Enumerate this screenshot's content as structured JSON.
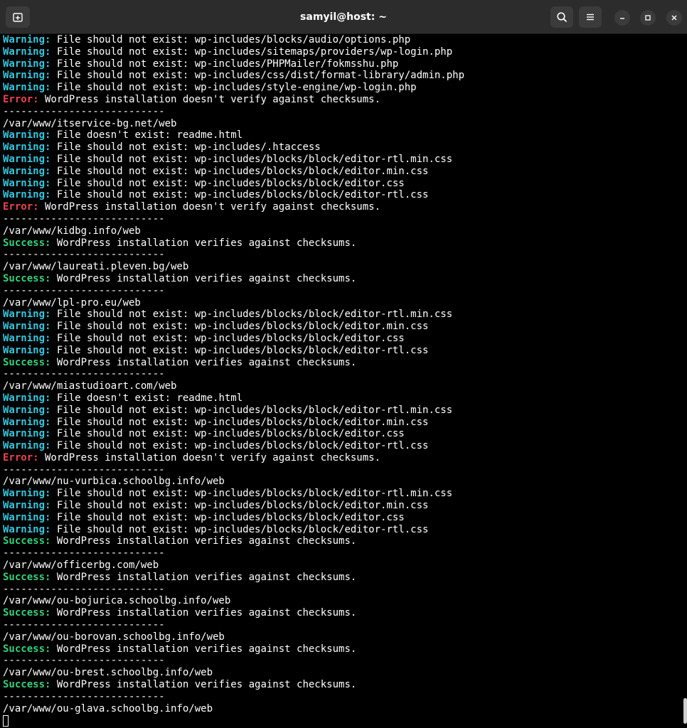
{
  "window": {
    "title": "samyil@host: ~"
  },
  "icons": {
    "new_tab": "new-tab-icon",
    "search": "search-icon",
    "menu": "hamburger-menu-icon",
    "minimize": "minimize-icon",
    "maximize": "maximize-icon",
    "close": "close-icon"
  },
  "colors": {
    "warning": "#33c7de",
    "error": "#f0414f",
    "success": "#33d17a",
    "text": "#ffffff",
    "background": "#000000"
  },
  "terminal": {
    "lines": [
      {
        "level": "Warning:",
        "text": " File should not exist: wp-includes/blocks/audio/options.php"
      },
      {
        "level": "Warning:",
        "text": " File should not exist: wp-includes/sitemaps/providers/wp-login.php"
      },
      {
        "level": "Warning:",
        "text": " File should not exist: wp-includes/PHPMailer/fokmsshu.php"
      },
      {
        "level": "Warning:",
        "text": " File should not exist: wp-includes/css/dist/format-library/admin.php"
      },
      {
        "level": "Warning:",
        "text": " File should not exist: wp-includes/style-engine/wp-login.php"
      },
      {
        "level": "Error:",
        "text": " WordPress installation doesn't verify against checksums."
      },
      {
        "level": "",
        "text": "---------------------------"
      },
      {
        "level": "",
        "text": "/var/www/itservice-bg.net/web"
      },
      {
        "level": "Warning:",
        "text": " File doesn't exist: readme.html"
      },
      {
        "level": "Warning:",
        "text": " File should not exist: wp-includes/.htaccess"
      },
      {
        "level": "Warning:",
        "text": " File should not exist: wp-includes/blocks/block/editor-rtl.min.css"
      },
      {
        "level": "Warning:",
        "text": " File should not exist: wp-includes/blocks/block/editor.min.css"
      },
      {
        "level": "Warning:",
        "text": " File should not exist: wp-includes/blocks/block/editor.css"
      },
      {
        "level": "Warning:",
        "text": " File should not exist: wp-includes/blocks/block/editor-rtl.css"
      },
      {
        "level": "Error:",
        "text": " WordPress installation doesn't verify against checksums."
      },
      {
        "level": "",
        "text": "---------------------------"
      },
      {
        "level": "",
        "text": "/var/www/kidbg.info/web"
      },
      {
        "level": "Success:",
        "text": " WordPress installation verifies against checksums."
      },
      {
        "level": "",
        "text": "---------------------------"
      },
      {
        "level": "",
        "text": "/var/www/laureati.pleven.bg/web"
      },
      {
        "level": "Success:",
        "text": " WordPress installation verifies against checksums."
      },
      {
        "level": "",
        "text": "---------------------------"
      },
      {
        "level": "",
        "text": "/var/www/lpl-pro.eu/web"
      },
      {
        "level": "Warning:",
        "text": " File should not exist: wp-includes/blocks/block/editor-rtl.min.css"
      },
      {
        "level": "Warning:",
        "text": " File should not exist: wp-includes/blocks/block/editor.min.css"
      },
      {
        "level": "Warning:",
        "text": " File should not exist: wp-includes/blocks/block/editor.css"
      },
      {
        "level": "Warning:",
        "text": " File should not exist: wp-includes/blocks/block/editor-rtl.css"
      },
      {
        "level": "Success:",
        "text": " WordPress installation verifies against checksums."
      },
      {
        "level": "",
        "text": "---------------------------"
      },
      {
        "level": "",
        "text": "/var/www/miastudioart.com/web"
      },
      {
        "level": "Warning:",
        "text": " File doesn't exist: readme.html"
      },
      {
        "level": "Warning:",
        "text": " File should not exist: wp-includes/blocks/block/editor-rtl.min.css"
      },
      {
        "level": "Warning:",
        "text": " File should not exist: wp-includes/blocks/block/editor.min.css"
      },
      {
        "level": "Warning:",
        "text": " File should not exist: wp-includes/blocks/block/editor.css"
      },
      {
        "level": "Warning:",
        "text": " File should not exist: wp-includes/blocks/block/editor-rtl.css"
      },
      {
        "level": "Error:",
        "text": " WordPress installation doesn't verify against checksums."
      },
      {
        "level": "",
        "text": "---------------------------"
      },
      {
        "level": "",
        "text": "/var/www/nu-vurbica.schoolbg.info/web"
      },
      {
        "level": "Warning:",
        "text": " File should not exist: wp-includes/blocks/block/editor-rtl.min.css"
      },
      {
        "level": "Warning:",
        "text": " File should not exist: wp-includes/blocks/block/editor.min.css"
      },
      {
        "level": "Warning:",
        "text": " File should not exist: wp-includes/blocks/block/editor.css"
      },
      {
        "level": "Warning:",
        "text": " File should not exist: wp-includes/blocks/block/editor-rtl.css"
      },
      {
        "level": "Success:",
        "text": " WordPress installation verifies against checksums."
      },
      {
        "level": "",
        "text": "---------------------------"
      },
      {
        "level": "",
        "text": "/var/www/officerbg.com/web"
      },
      {
        "level": "Success:",
        "text": " WordPress installation verifies against checksums."
      },
      {
        "level": "",
        "text": "---------------------------"
      },
      {
        "level": "",
        "text": "/var/www/ou-bojurica.schoolbg.info/web"
      },
      {
        "level": "Success:",
        "text": " WordPress installation verifies against checksums."
      },
      {
        "level": "",
        "text": "---------------------------"
      },
      {
        "level": "",
        "text": "/var/www/ou-borovan.schoolbg.info/web"
      },
      {
        "level": "Success:",
        "text": " WordPress installation verifies against checksums."
      },
      {
        "level": "",
        "text": "---------------------------"
      },
      {
        "level": "",
        "text": "/var/www/ou-brest.schoolbg.info/web"
      },
      {
        "level": "Success:",
        "text": " WordPress installation verifies against checksums."
      },
      {
        "level": "",
        "text": "---------------------------"
      },
      {
        "level": "",
        "text": "/var/www/ou-glava.schoolbg.info/web"
      }
    ]
  }
}
